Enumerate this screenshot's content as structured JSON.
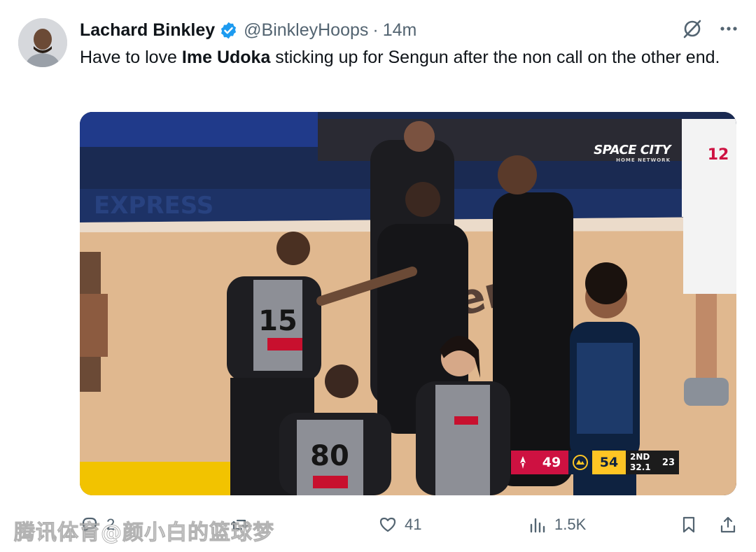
{
  "tweet": {
    "author_name": "Lachard Binkley",
    "handle": "@BinkleyHoops",
    "separator": "·",
    "time": "14m",
    "text_before": "Have to love ",
    "text_bold": "Ime Udoka",
    "text_after": " sticking up for Sengun after the non call on the other end."
  },
  "media": {
    "broadcast_brand": "SPACE CITY",
    "broadcast_sub": "HOME NETWORK",
    "jersey_ref_left": "15",
    "jersey_ref_bottom": "80",
    "scorebug": {
      "home_score": "49",
      "away_score": "54",
      "period": "2ND",
      "clock": "32.1",
      "shot_clock": "23"
    }
  },
  "actions": {
    "replies": "2",
    "likes": "41",
    "views": "1.5K"
  },
  "overlay_watermark": "腾讯体育@颜小白的篮球梦",
  "colors": {
    "verified": "#1d9bf0",
    "muted": "#536471",
    "rockets_red": "#ce1141",
    "nuggets_gold": "#fec524",
    "nuggets_navy": "#0e2240"
  }
}
